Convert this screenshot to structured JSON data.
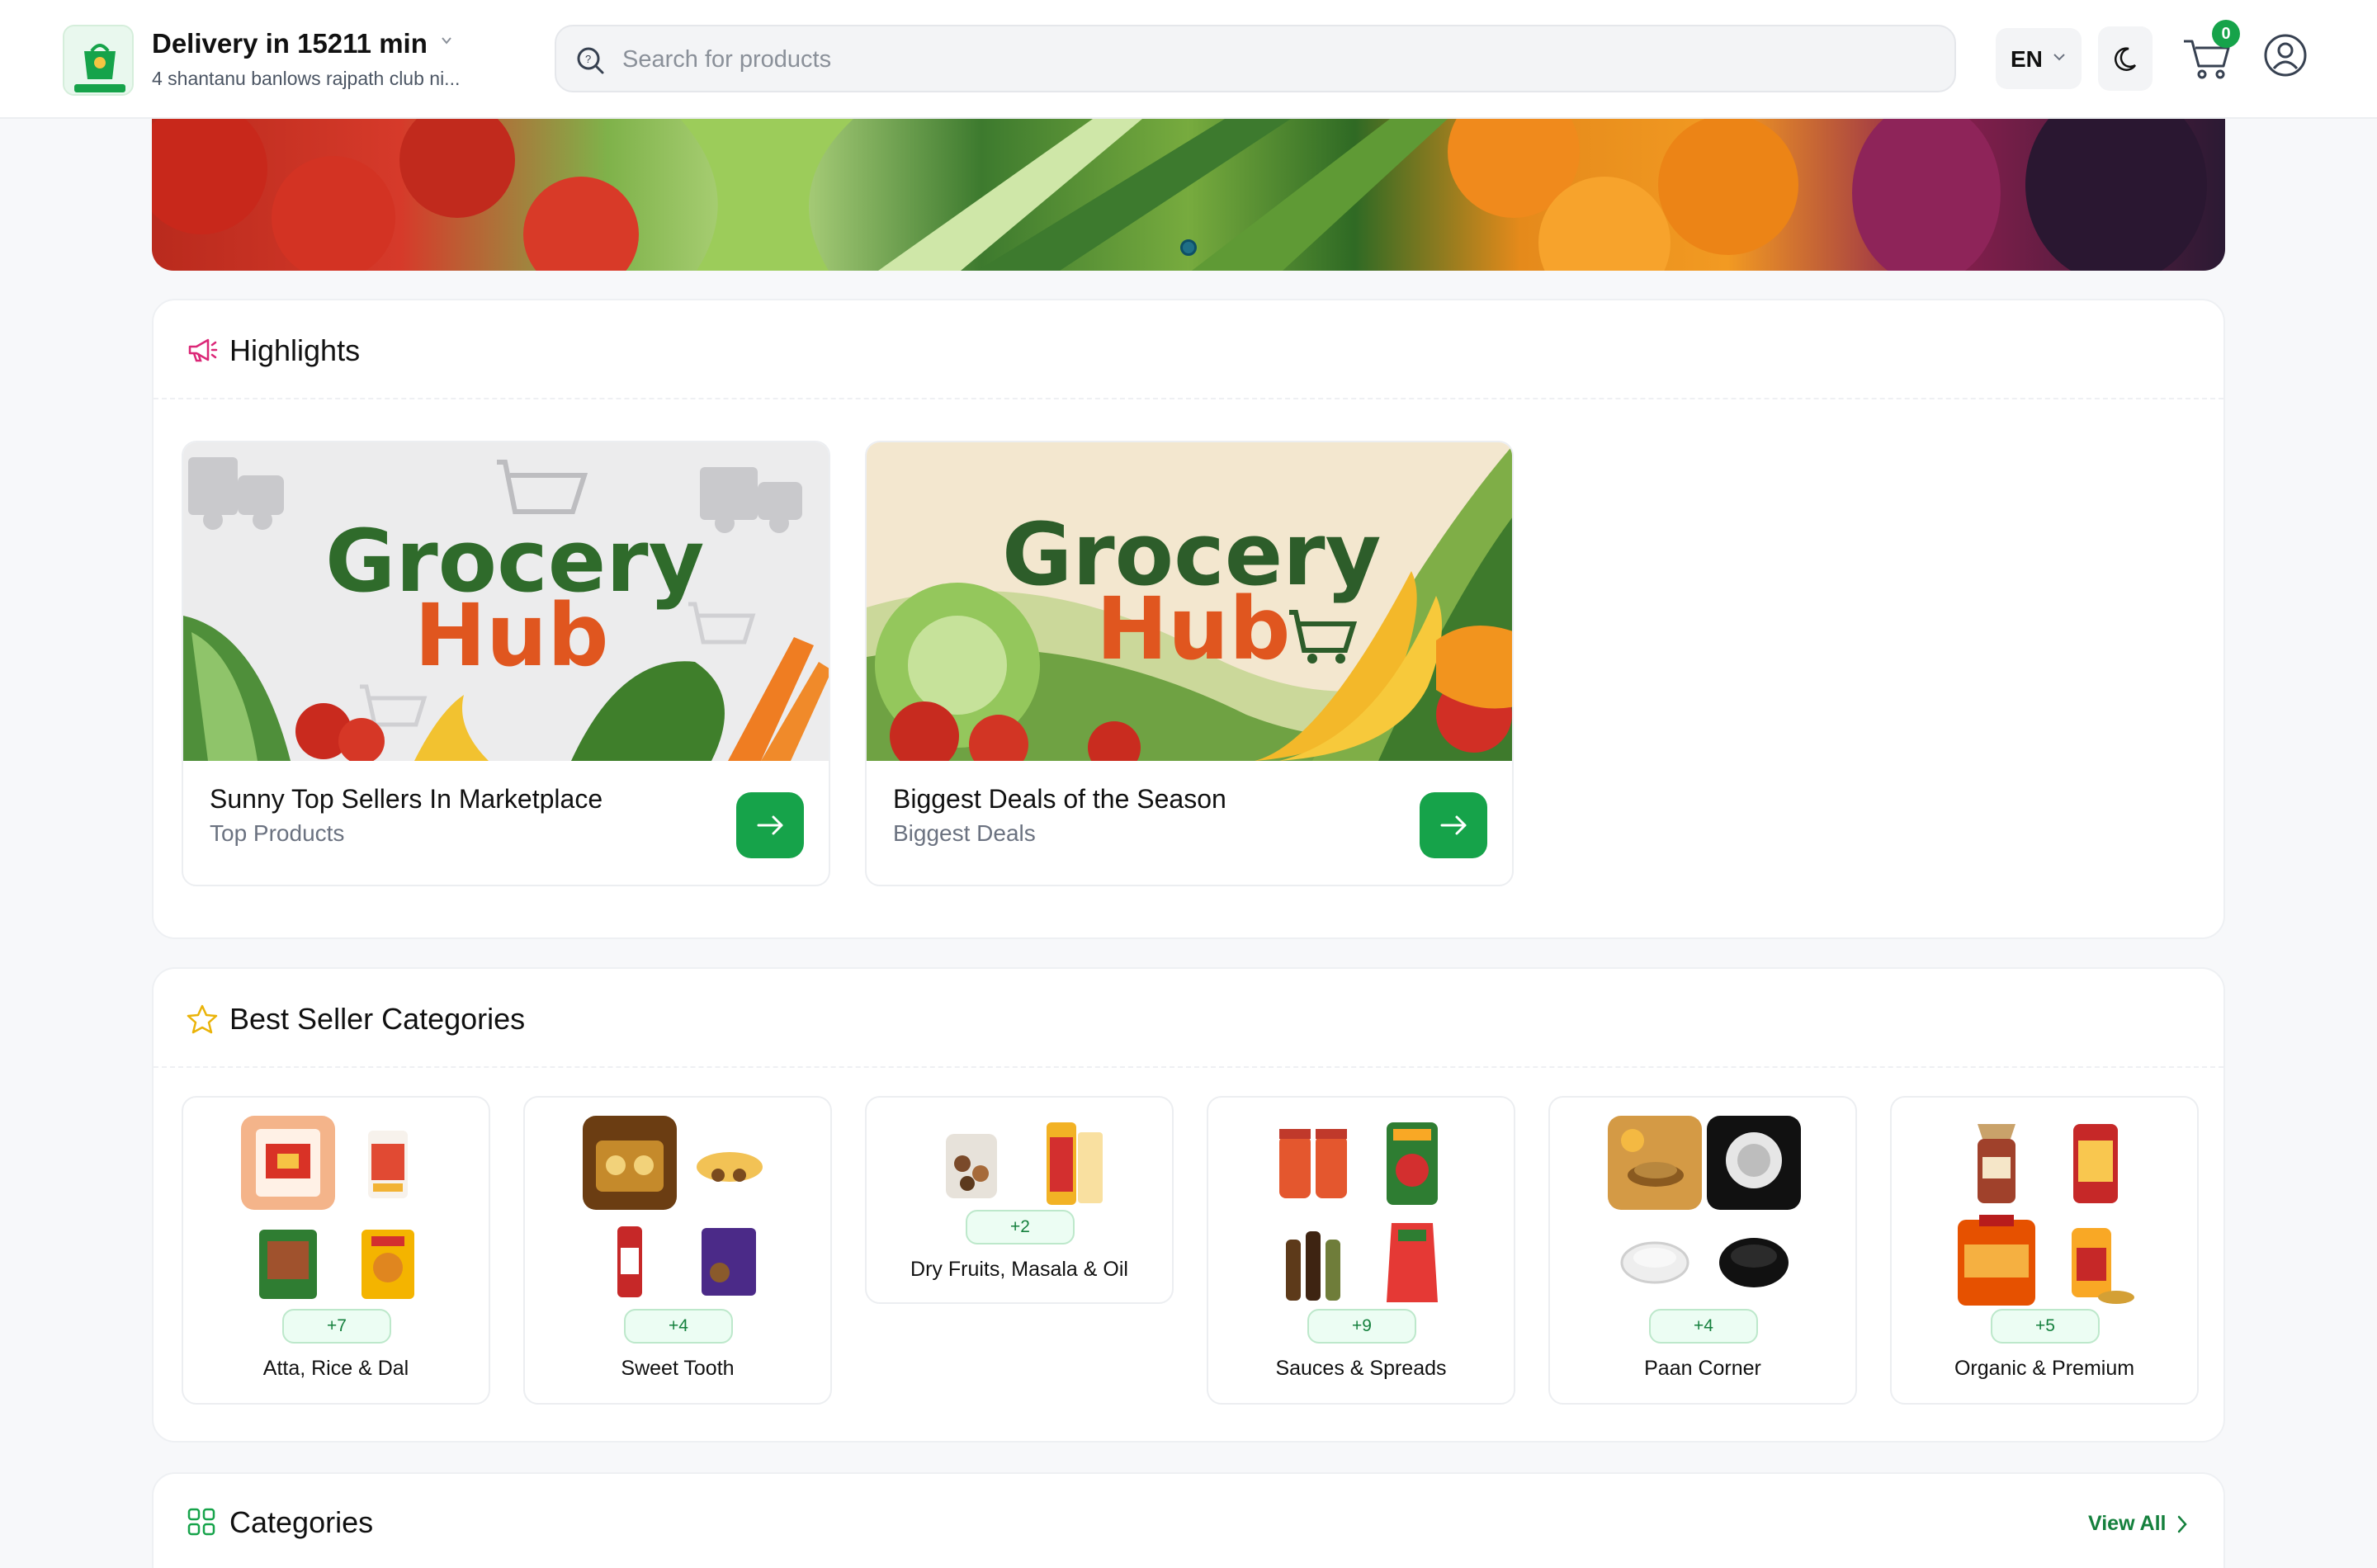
{
  "header": {
    "delivery_title": "Delivery in 15211 min",
    "address": "4 shantanu banlows rajpath club ni...",
    "search_placeholder": "Search for products",
    "language": "EN",
    "cart_count": "0"
  },
  "banner": {
    "active_slide": 1
  },
  "highlights": {
    "title": "Highlights",
    "cards": [
      {
        "title": "Sunny Top Sellers In Marketplace",
        "subtitle": "Top Products",
        "image_text_1": "Grocery",
        "image_text_2": "Hub"
      },
      {
        "title": "Biggest Deals of the Season",
        "subtitle": "Biggest Deals",
        "image_text_1": "Grocery",
        "image_text_2": "Hub"
      }
    ]
  },
  "best_seller": {
    "title": "Best Seller Categories",
    "tiles": [
      {
        "label": "Atta, Rice & Dal",
        "more": "+7"
      },
      {
        "label": "Sweet Tooth",
        "more": "+4"
      },
      {
        "label": "Dry Fruits, Masala & Oil",
        "more": "+2"
      },
      {
        "label": "Sauces & Spreads",
        "more": "+9"
      },
      {
        "label": "Paan Corner",
        "more": "+4"
      },
      {
        "label": "Organic & Premium",
        "more": "+5"
      }
    ]
  },
  "categories": {
    "title": "Categories",
    "view_all": "View All"
  },
  "colors": {
    "brand_green": "#16a34a",
    "brand_orange": "#e0561f",
    "text_dark": "#111827",
    "text_muted": "#6b7280"
  },
  "icons": [
    "logo-icon",
    "chevron-down-icon",
    "search-icon",
    "moon-icon",
    "cart-icon",
    "user-icon",
    "megaphone-icon",
    "star-icon",
    "grid-icon",
    "arrow-right-icon",
    "chevron-right-icon"
  ]
}
